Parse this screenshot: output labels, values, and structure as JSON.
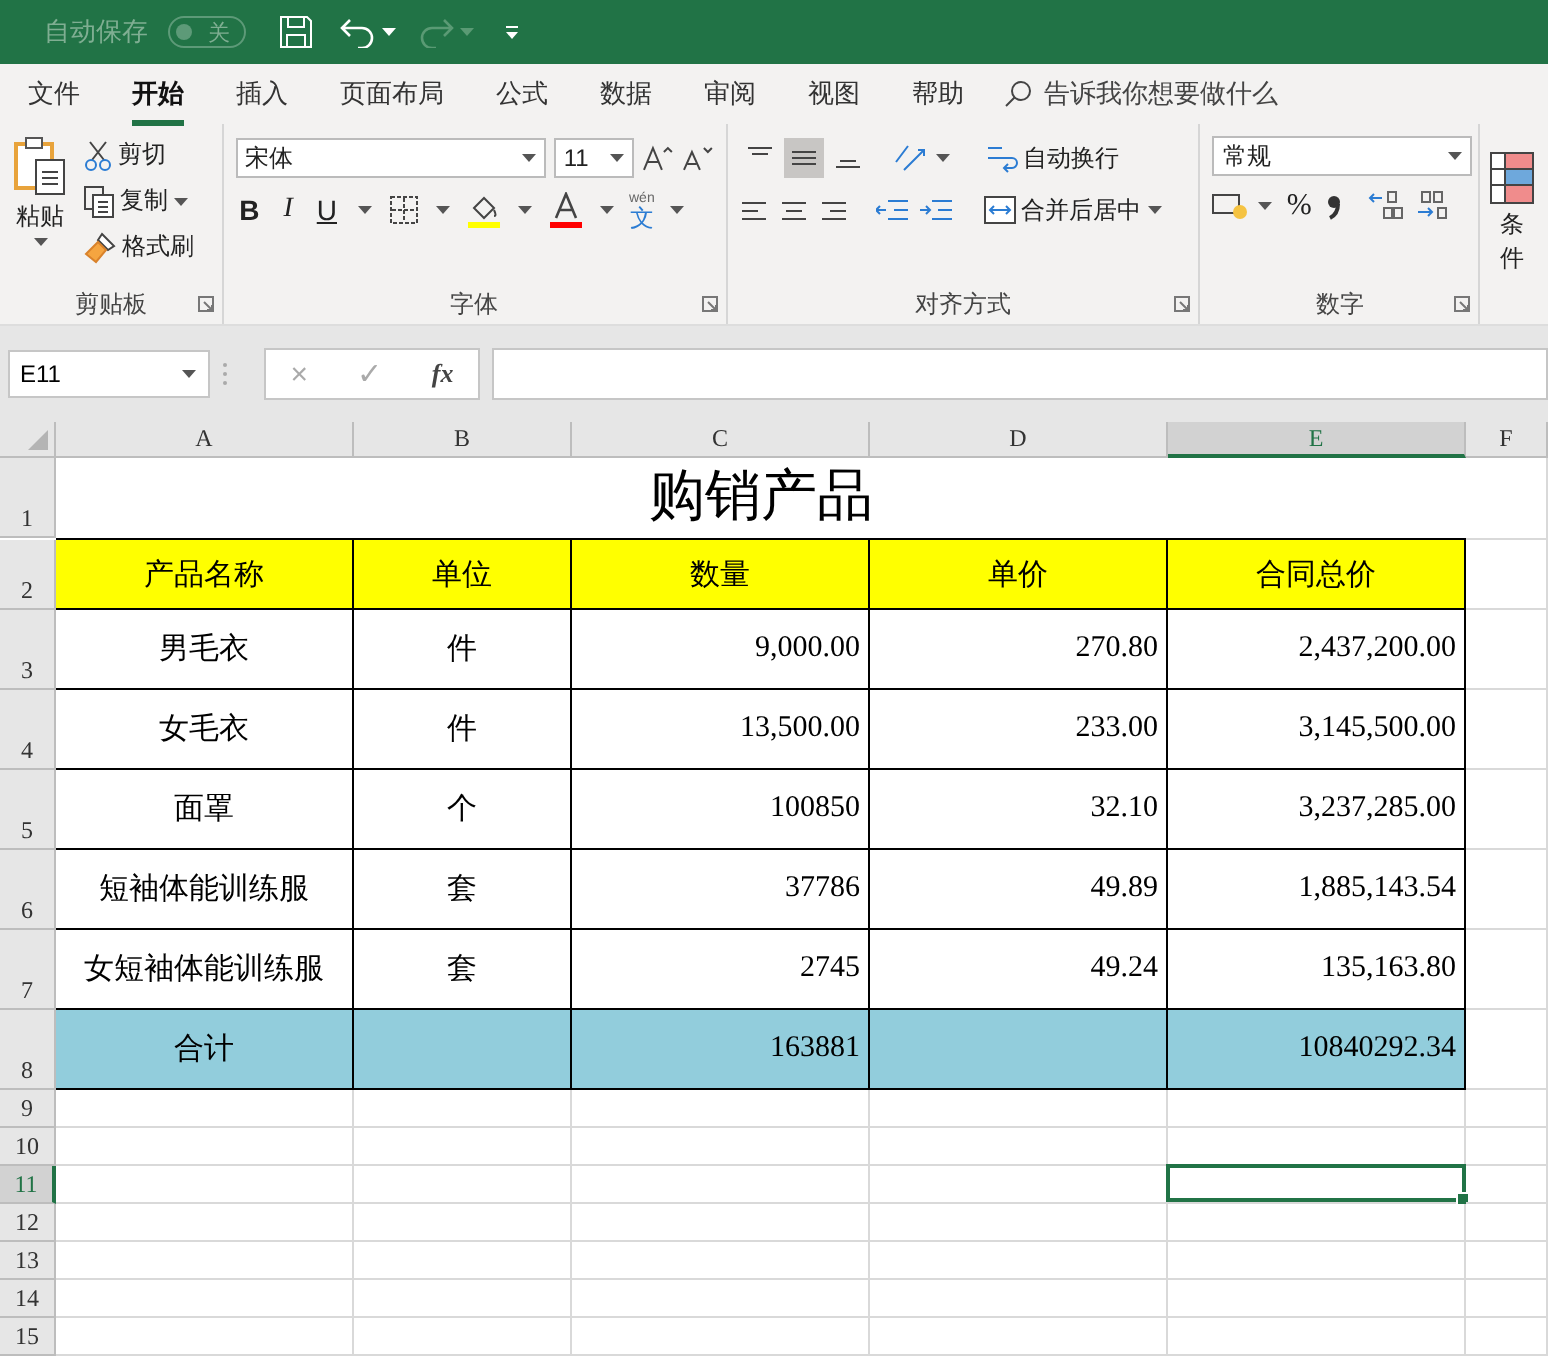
{
  "title_bar": {
    "autosave_label": "自动保存",
    "autosave_toggle": {
      "on": false,
      "label": "关"
    },
    "redo": {
      "disabled": true
    }
  },
  "tabs": [
    {
      "label": "文件",
      "selected": false
    },
    {
      "label": "开始",
      "selected": true
    },
    {
      "label": "插入",
      "selected": false
    },
    {
      "label": "页面布局",
      "selected": false
    },
    {
      "label": "公式",
      "selected": false
    },
    {
      "label": "数据",
      "selected": false
    },
    {
      "label": "审阅",
      "selected": false
    },
    {
      "label": "视图",
      "selected": false
    },
    {
      "label": "帮助",
      "selected": false
    }
  ],
  "tell_me": {
    "placeholder": "告诉我你想要做什么"
  },
  "ribbon": {
    "clipboard": {
      "paste": "粘贴",
      "cut": "剪切",
      "copy": "复制",
      "format_painter": "格式刷",
      "label": "剪贴板"
    },
    "font": {
      "name": "宋体",
      "size": "11",
      "bold": "B",
      "italic": "I",
      "underline": "U",
      "phonetic_top": "wén",
      "phonetic": "文",
      "label": "字体"
    },
    "alignment": {
      "vertical_buttons": [
        {
          "selected": false
        },
        {
          "selected": true
        },
        {
          "selected": false
        }
      ],
      "wrap_text": "自动换行",
      "merge_center": "合并后居中",
      "label": "对齐方式"
    },
    "number": {
      "format": "常规",
      "percent": "%",
      "label": "数字"
    },
    "styles": {
      "conditional": "条件"
    }
  },
  "formula_bar": {
    "name_box": "E11",
    "cancel": "×",
    "enter": "✓",
    "function": "fx"
  },
  "columns": [
    {
      "label": "A",
      "selected": false
    },
    {
      "label": "B",
      "selected": false
    },
    {
      "label": "C",
      "selected": false
    },
    {
      "label": "D",
      "selected": false
    },
    {
      "label": "E",
      "selected": true
    },
    {
      "label": "F",
      "selected": false
    }
  ],
  "rows": [
    {
      "header": "1",
      "selected": false,
      "kind": "title",
      "text": "购销产品"
    },
    {
      "header": "2",
      "selected": false,
      "kind": "header",
      "cells": [
        "产品名称",
        "单位",
        "数量",
        "单价",
        "合同总价"
      ]
    },
    {
      "header": "3",
      "selected": false,
      "kind": "data",
      "cells": [
        "男毛衣",
        "件",
        "9,000.00",
        "270.80",
        "2,437,200.00"
      ]
    },
    {
      "header": "4",
      "selected": false,
      "kind": "data",
      "cells": [
        "女毛衣",
        "件",
        "13,500.00",
        "233.00",
        "3,145,500.00"
      ]
    },
    {
      "header": "5",
      "selected": false,
      "kind": "data",
      "cells": [
        "面罩",
        "个",
        "100850",
        "32.10",
        "3,237,285.00"
      ]
    },
    {
      "header": "6",
      "selected": false,
      "kind": "data",
      "cells": [
        "短袖体能训练服",
        "套",
        "37786",
        "49.89",
        "1,885,143.54"
      ]
    },
    {
      "header": "7",
      "selected": false,
      "kind": "data",
      "cells": [
        "女短袖体能训练服",
        "套",
        "2745",
        "49.24",
        "135,163.80"
      ]
    },
    {
      "header": "8",
      "selected": false,
      "kind": "total",
      "cells": [
        "合计",
        null,
        "163881",
        null,
        "10840292.34"
      ]
    },
    {
      "header": "9",
      "selected": false,
      "kind": "empty"
    },
    {
      "header": "10",
      "selected": false,
      "kind": "empty"
    },
    {
      "header": "11",
      "selected": true,
      "kind": "empty"
    },
    {
      "header": "12",
      "selected": false,
      "kind": "empty"
    },
    {
      "header": "13",
      "selected": false,
      "kind": "empty"
    },
    {
      "header": "14",
      "selected": false,
      "kind": "empty"
    },
    {
      "header": "15",
      "selected": false,
      "kind": "empty"
    }
  ]
}
